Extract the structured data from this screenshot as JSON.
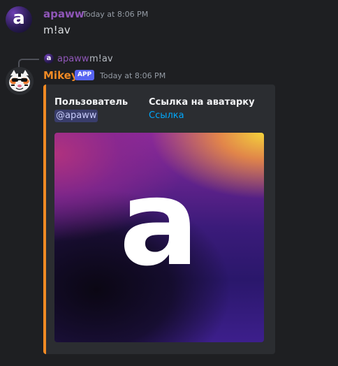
{
  "messages": [
    {
      "username": "apaww",
      "username_color": "#8f56b8",
      "timestamp": "Today at 8:06 PM",
      "avatar_letter": "a",
      "text": "m!av"
    }
  ],
  "reply": {
    "reply_username": "apaww",
    "reply_text": "m!av",
    "reply_avatar_letter": "a"
  },
  "bot": {
    "username": "Mikey",
    "username_color": "#f08a24",
    "badge": "APP",
    "timestamp": "Today at 8:06 PM",
    "avatar_icon": "tiger-avatar-icon"
  },
  "embed": {
    "accent_color": "#f08a24",
    "fields": [
      {
        "name": "Пользователь",
        "value": "@apaww"
      },
      {
        "name": "Ссылка на аватарку",
        "value": "Ссылка"
      }
    ],
    "image_letter": "a"
  }
}
